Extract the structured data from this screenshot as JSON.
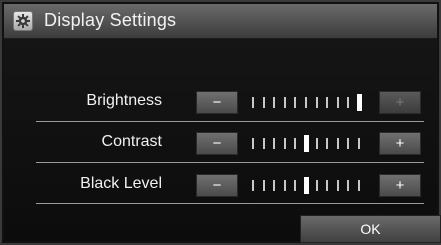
{
  "window": {
    "title": "Display Settings",
    "icon": "gear-icon"
  },
  "settings": [
    {
      "label": "Brightness",
      "minus_label": "−",
      "plus_label": "+",
      "level": 11,
      "max_level": 11,
      "plus_enabled": false
    },
    {
      "label": "Contrast",
      "minus_label": "−",
      "plus_label": "+",
      "level": 6,
      "max_level": 11,
      "plus_enabled": true
    },
    {
      "label": "Black Level",
      "minus_label": "−",
      "plus_label": "+",
      "level": 6,
      "max_level": 11,
      "plus_enabled": true
    }
  ],
  "footer": {
    "ok_label": "OK"
  },
  "colors": {
    "tick_active": "#ffffff",
    "tick_inactive": "#c8c8c8",
    "button": "#5e5e5e"
  }
}
